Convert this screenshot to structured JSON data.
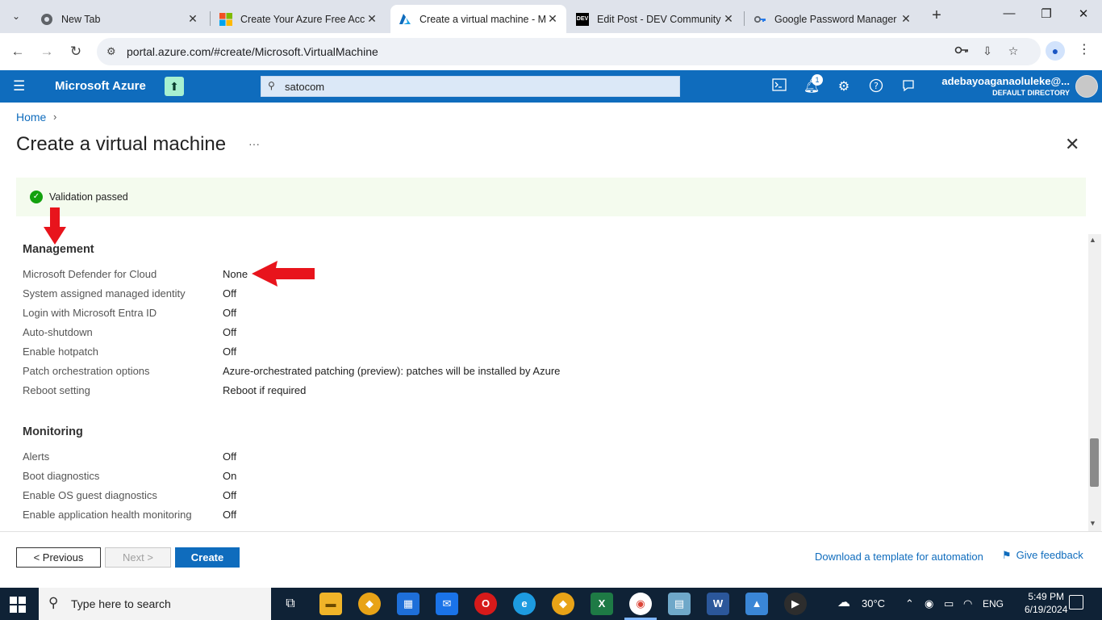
{
  "browser": {
    "tabs": [
      {
        "title": "New Tab",
        "favicon": "chrome-icon"
      },
      {
        "title": "Create Your Azure Free Acco",
        "favicon": "microsoft-icon"
      },
      {
        "title": "Create a virtual machine - M",
        "favicon": "azure-icon"
      },
      {
        "title": "Edit Post - DEV Community",
        "favicon": "dev-icon"
      },
      {
        "title": "Google Password Manager",
        "favicon": "key-icon"
      }
    ],
    "url": "portal.azure.com/#create/Microsoft.VirtualMachine"
  },
  "azure_header": {
    "brand": "Microsoft Azure",
    "search_value": "satocom",
    "notification_count": "1",
    "account_name": "adebayoaganaoluleke@...",
    "directory": "DEFAULT DIRECTORY"
  },
  "page": {
    "breadcrumb_home": "Home",
    "breadcrumb_sep": "›",
    "title": "Create a virtual machine",
    "more": "···",
    "validation_message": "Validation passed"
  },
  "sections": {
    "management": {
      "title": "Management",
      "rows": [
        {
          "label": "Microsoft Defender for Cloud",
          "value": "None"
        },
        {
          "label": "System assigned managed identity",
          "value": "Off"
        },
        {
          "label": "Login with Microsoft Entra ID",
          "value": "Off"
        },
        {
          "label": "Auto-shutdown",
          "value": "Off"
        },
        {
          "label": "Enable hotpatch",
          "value": "Off"
        },
        {
          "label": "Patch orchestration options",
          "value": "Azure-orchestrated patching (preview): patches will be installed by Azure"
        },
        {
          "label": "Reboot setting",
          "value": "Reboot if required"
        }
      ]
    },
    "monitoring": {
      "title": "Monitoring",
      "rows": [
        {
          "label": "Alerts",
          "value": "Off"
        },
        {
          "label": "Boot diagnostics",
          "value": "On"
        },
        {
          "label": "Enable OS guest diagnostics",
          "value": "Off"
        },
        {
          "label": "Enable application health monitoring",
          "value": "Off"
        }
      ]
    }
  },
  "footer": {
    "previous": "< Previous",
    "next": "Next >",
    "create": "Create",
    "download_template": "Download a template for automation",
    "feedback": "Give feedback"
  },
  "taskbar": {
    "search_placeholder": "Type here to search",
    "temperature": "30°C",
    "language": "ENG",
    "time": "5:49 PM",
    "date": "6/19/2024"
  },
  "colors": {
    "azure_blue": "#0f6cbd",
    "validation_bg": "#f4fbee",
    "success_green": "#13a10e",
    "annotation_red": "#e8141c"
  }
}
